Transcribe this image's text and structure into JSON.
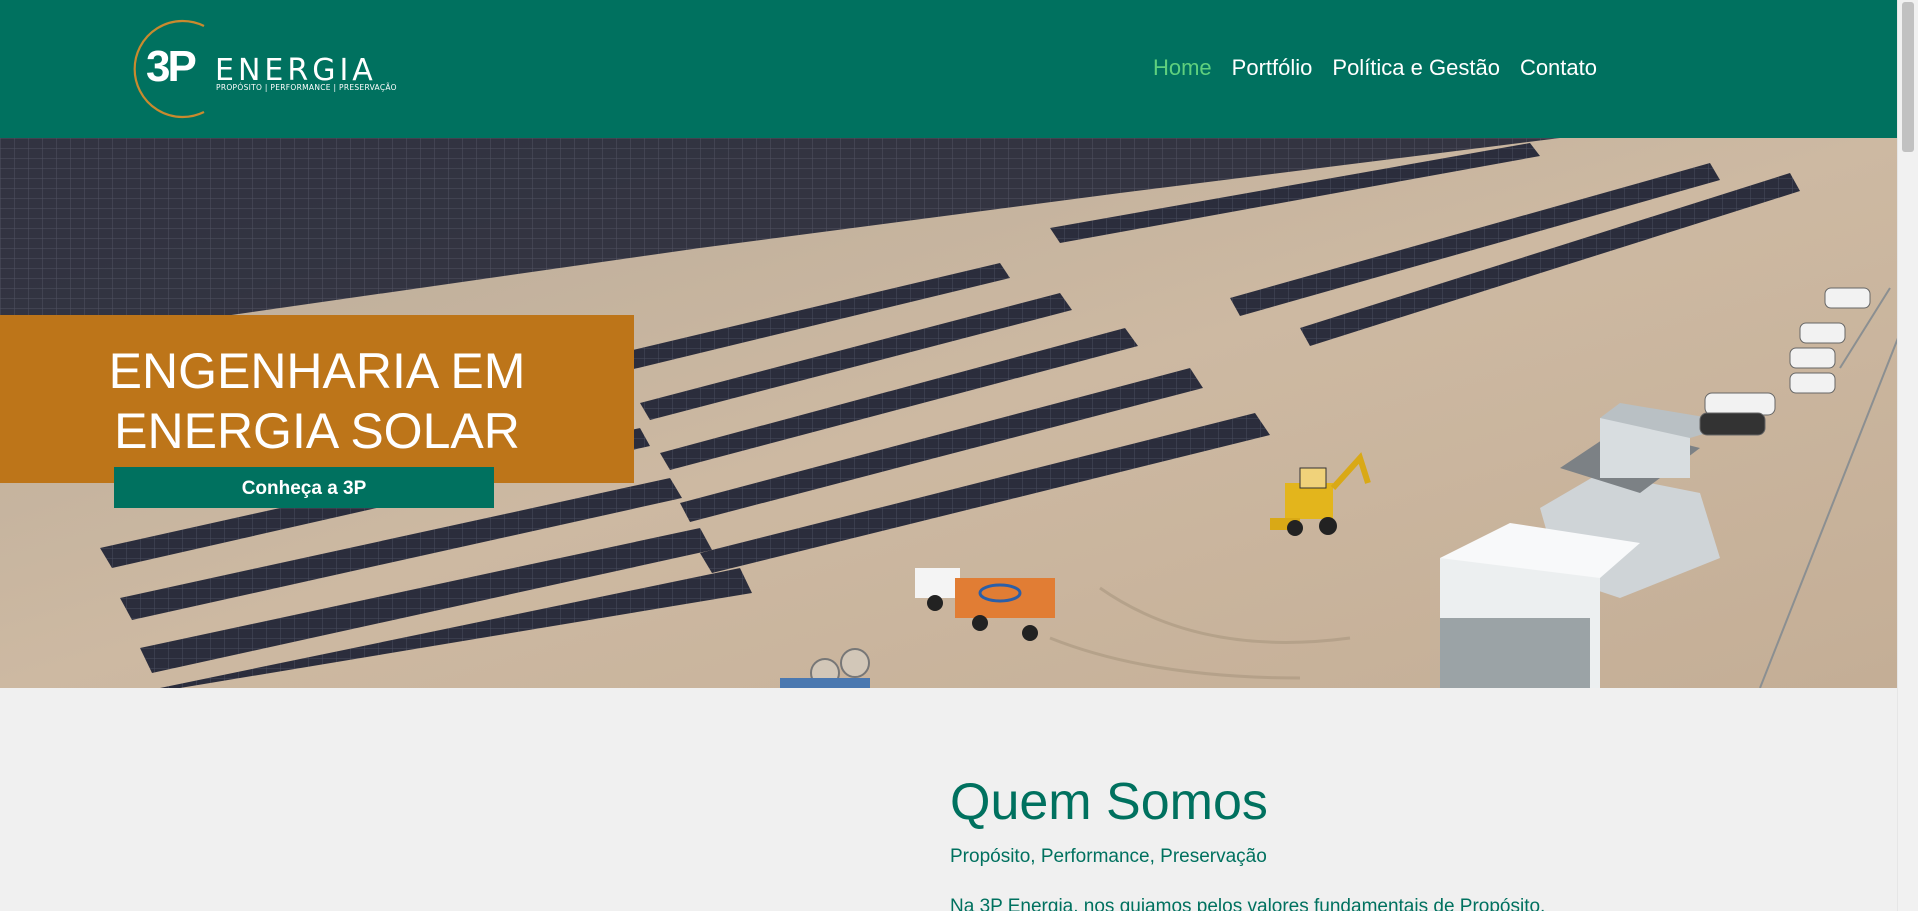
{
  "brand": {
    "logo_mark": "3P",
    "logo_name": "ENERGIA",
    "logo_tagline": "PROPÓSITO | PERFORMANCE | PRESERVAÇÃO"
  },
  "nav": {
    "items": [
      {
        "label": "Home",
        "active": true
      },
      {
        "label": "Portfólio",
        "active": false
      },
      {
        "label": "Política e Gestão",
        "active": false
      },
      {
        "label": "Contato",
        "active": false
      }
    ]
  },
  "hero": {
    "title_line1": "ENGENHARIA EM",
    "title_line2": "ENERGIA SOLAR",
    "cta_label": "Conheça a 3P"
  },
  "about": {
    "title": "Quem Somos",
    "subtitle": "Propósito, Performance, Preservação",
    "text": "Na 3P Energia, nos guiamos pelos valores fundamentais de Propósito,"
  },
  "colors": {
    "header_bg": "#00715f",
    "nav_active": "#5fd07e",
    "hero_box": "#bd7519",
    "accent_orange": "#c98a2e",
    "page_bg": "#f0f0f0"
  }
}
